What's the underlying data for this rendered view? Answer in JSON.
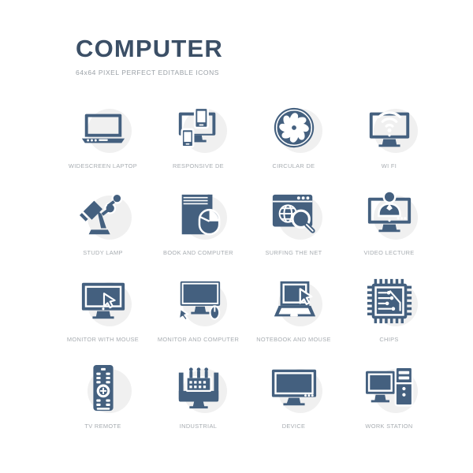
{
  "header": {
    "title": "COMPUTER",
    "subtitle": "64x64 PIXEL PERFECT EDITABLE ICONS"
  },
  "colors": {
    "icon": "#44607f",
    "icon_dark": "#3b4f66",
    "disc": "#f0f0f0",
    "label": "#a7acb1",
    "background": "#ffffff"
  },
  "grid": {
    "columns": 4,
    "rows": 4,
    "items": [
      {
        "icon": "widescreen-laptop-icon",
        "label": "WIDESCREEN LAPTOP"
      },
      {
        "icon": "responsive-design-icon",
        "label": "RESPONSIVE DE"
      },
      {
        "icon": "circular-design-fan-icon",
        "label": "CIRCULAR DE"
      },
      {
        "icon": "wifi-monitor-icon",
        "label": "WI FI"
      },
      {
        "icon": "study-lamp-icon",
        "label": "STUDY LAMP"
      },
      {
        "icon": "book-and-computer-icon",
        "label": "BOOK AND COMPUTER"
      },
      {
        "icon": "surfing-the-net-icon",
        "label": "SURFING THE NET"
      },
      {
        "icon": "video-lecture-icon",
        "label": "VIDEO LECTURE"
      },
      {
        "icon": "monitor-with-mouse-icon",
        "label": "MONITOR WITH MOUSE"
      },
      {
        "icon": "monitor-and-computer-icon",
        "label": "MONITOR AND COMPUTER"
      },
      {
        "icon": "notebook-and-mouse-icon",
        "label": "NOTEBOOK AND MOUSE"
      },
      {
        "icon": "chips-icon",
        "label": "CHIPS"
      },
      {
        "icon": "tv-remote-icon",
        "label": "TV REMOTE"
      },
      {
        "icon": "industrial-icon",
        "label": "INDUSTRIAL"
      },
      {
        "icon": "device-monitor-icon",
        "label": "DEVICE"
      },
      {
        "icon": "work-station-icon",
        "label": "WORK STATION"
      }
    ]
  }
}
